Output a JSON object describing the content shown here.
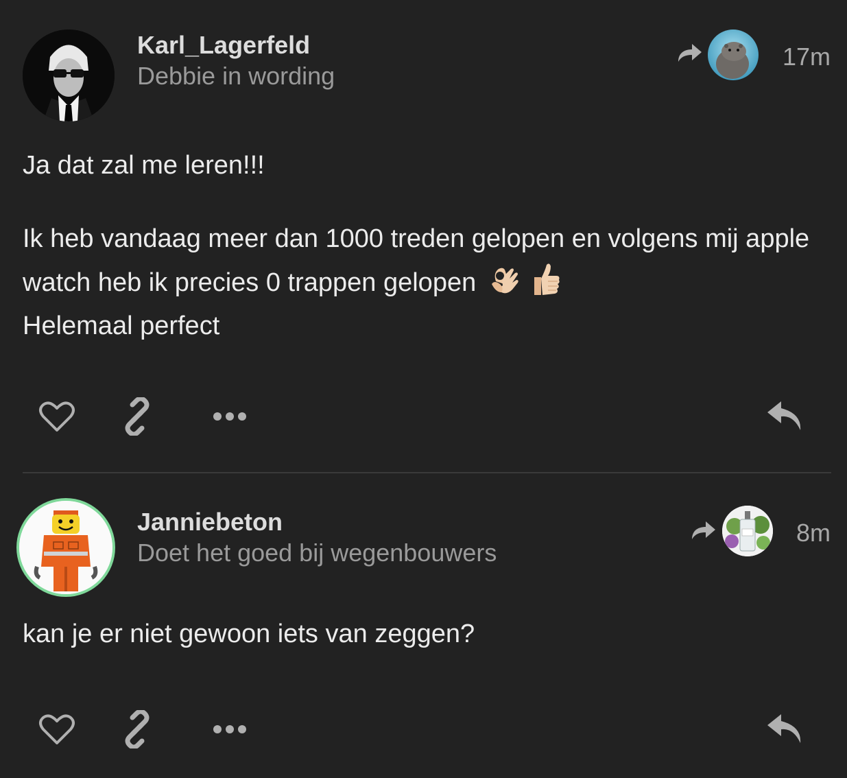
{
  "posts": [
    {
      "avatar": "karl-lagerfeld-avatar",
      "username": "Karl_Lagerfeld",
      "user_title": "Debbie in wording",
      "reply_to_avatar": "hippo-avatar",
      "time": "17m",
      "paragraphs": [
        "Ja dat zal me leren!!!",
        "Ik heb vandaag meer dan 1000 treden gelopen en volgens mij apple watch heb ik precies 0 trappen gelopen"
      ],
      "emojis": [
        "ok-hand-emoji",
        "thumbs-up-emoji"
      ],
      "last_line": "Helemaal perfect"
    },
    {
      "avatar": "lego-worker-avatar",
      "username": "Janniebeton",
      "user_title": "Doet het goed bij wegenbouwers",
      "reply_to_avatar": "gin-bottle-avatar",
      "time": "8m",
      "paragraphs": [
        "kan je er niet gewoon iets van zeggen?"
      ]
    }
  ],
  "icons": {
    "like": "heart-icon",
    "link": "link-icon",
    "more": "ellipsis-icon",
    "reply": "reply-icon",
    "reply_indicator": "share-arrow-icon"
  },
  "colors": {
    "background": "#222222",
    "avatar_ring": "#7fd89a",
    "icon": "#b0b0b0"
  }
}
